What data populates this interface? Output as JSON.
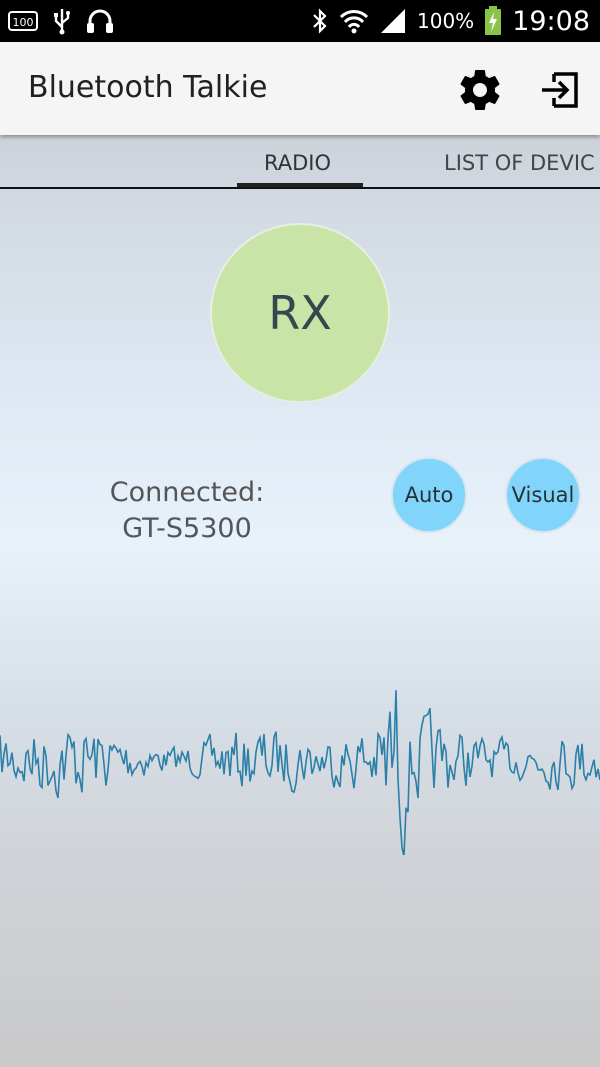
{
  "status_bar": {
    "battery_percent": "100%",
    "time": "19:08",
    "icons": [
      "battery-100-notification-icon",
      "usb-icon",
      "headphones-icon",
      "bluetooth-icon",
      "wifi-icon",
      "signal-icon",
      "battery-charging-icon"
    ]
  },
  "app_bar": {
    "title": "Bluetooth Talkie",
    "icons": [
      "gear-icon",
      "logout-icon"
    ]
  },
  "tabs": [
    {
      "label": "RADIO",
      "selected": true
    },
    {
      "label": "LIST OF DEVIC",
      "selected": false
    }
  ],
  "radio": {
    "rx_label": "RX",
    "status_line1": "Connected:",
    "status_line2": "GT-S5300",
    "auto_label": "Auto",
    "visual_label": "Visual"
  },
  "colors": {
    "rx_button": "#c9e4a7",
    "round_buttons": "#81d4fa",
    "waveform": "#2b7fa8",
    "app_bar": "#f5f5f5"
  }
}
